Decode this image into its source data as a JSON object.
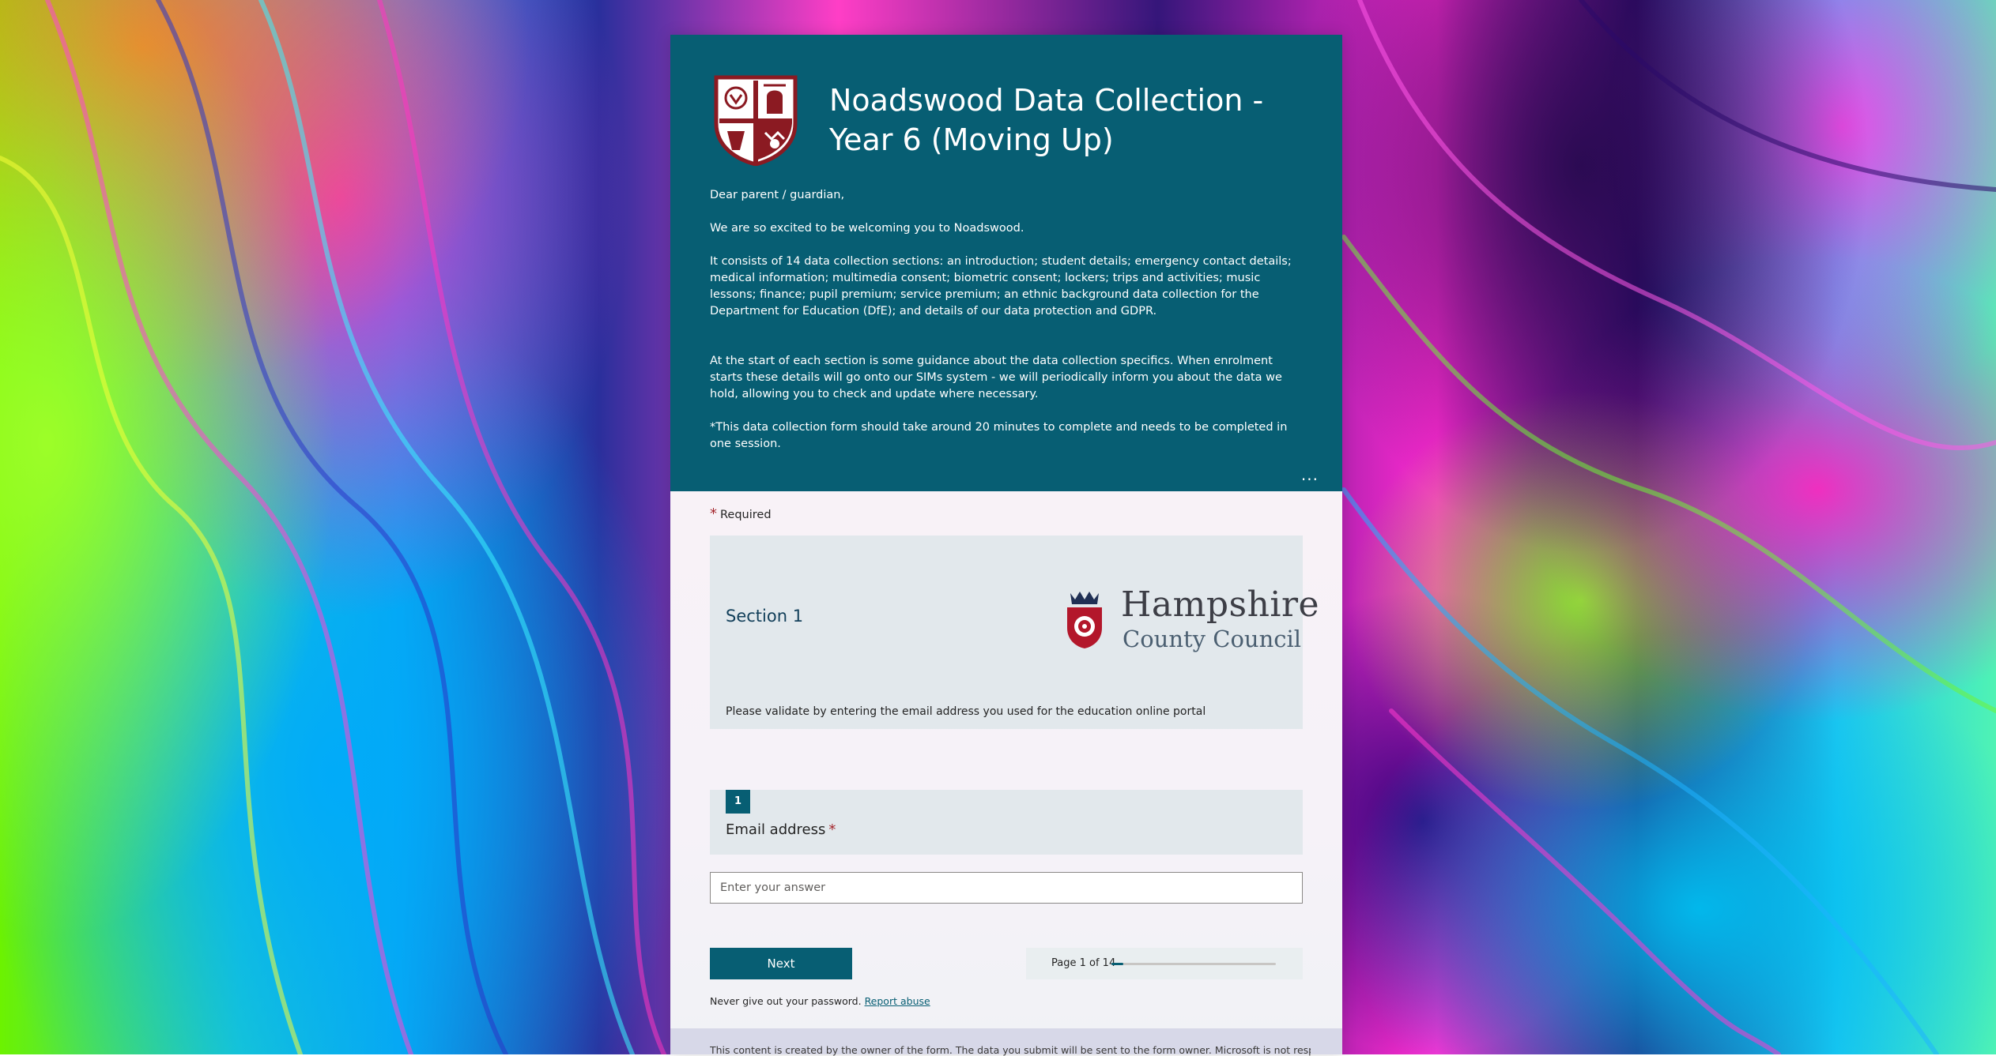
{
  "form": {
    "title": "Noadswood Data Collection - Year 6 (Moving Up)",
    "intro": [
      "Dear parent / guardian,",
      "We are so excited to be welcoming you to Noadswood.",
      "It consists of 14 data collection sections: an introduction; student details; emergency contact details; medical information; multimedia consent; biometric consent; lockers; trips and activities; music lessons; finance; pupil premium; service premium; an ethnic background data collection for the Department for Education (DfE); and details of our data protection and GDPR.",
      "At the start of each section is some guidance about the data collection specifics. When enrolment starts these details will go onto our SIMs system - we will periodically inform you about the data we hold, allowing you to check and update where necessary.",
      "*This data collection form should take around 20 minutes to complete and needs to be completed in one session."
    ],
    "more_label": "...",
    "required_star": "*",
    "required_label": "Required"
  },
  "section": {
    "title": "Section 1",
    "logo_line1": "Hampshire",
    "logo_line2": "County Council",
    "description": "Please validate by entering the email address you used for the education online portal"
  },
  "question": {
    "number": "1",
    "label": "Email address",
    "required_star": "*",
    "placeholder": "Enter your answer"
  },
  "navigation": {
    "next_label": "Next",
    "page_indicator": "Page 1 of 14",
    "progress_fraction": 0.0714
  },
  "notice": {
    "password_text": "Never give out your password.",
    "report_label": "Report abuse"
  },
  "footer": {
    "text": "This content is created by the owner of the form. The data you submit will be sent to the form owner. Microsoft is not responsible for the"
  },
  "colors": {
    "header_bg": "#075e73",
    "accent": "#075e73",
    "required": "#a4262c",
    "crest_red": "#8b1a22"
  }
}
